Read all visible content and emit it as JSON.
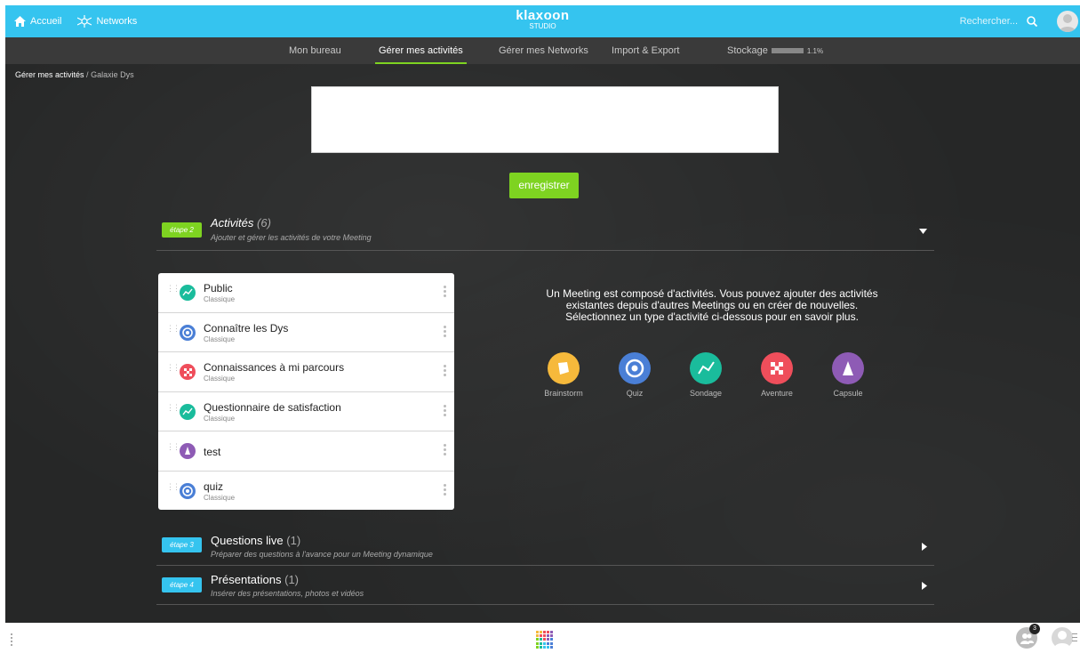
{
  "topbar": {
    "home_label": "Accueil",
    "networks_label": "Networks",
    "logo_line1": "klaxoon",
    "logo_line2": "STUDIO",
    "search_placeholder": "Rechercher..."
  },
  "subnav": {
    "tabs": [
      {
        "label": "Mon bureau"
      },
      {
        "label": "Gérer mes activités"
      },
      {
        "label": "Gérer mes Networks"
      },
      {
        "label": "Import & Export"
      },
      {
        "label": "Stockage"
      }
    ],
    "active_tab": "Gérer mes activités",
    "storage_pct": "1.1%"
  },
  "breadcrumb": {
    "root": "Gérer mes activités",
    "separator": "/",
    "current": "Galaxie Dys"
  },
  "save_label": "enregistrer",
  "steps": [
    {
      "badge": "étape 2",
      "title": "Activités",
      "count": "(6)",
      "subtitle": "Ajouter et gérer les activités de votre Meeting",
      "badge_color": "#7ed321"
    },
    {
      "badge": "étape 3",
      "title": "Questions live",
      "count": "(1)",
      "subtitle": "Préparer des questions à l'avance pour un Meeting dynamique",
      "badge_color": "#35c4ef"
    },
    {
      "badge": "étape 4",
      "title": "Présentations",
      "count": "(1)",
      "subtitle": "Insérer des présentations, photos et vidéos",
      "badge_color": "#35c4ef"
    }
  ],
  "activities": [
    {
      "name": "Public",
      "type": "Classique",
      "icon": "sondage-icon",
      "color": "#1abc9c"
    },
    {
      "name": "Connaître les Dys",
      "type": "Classique",
      "icon": "quiz-icon",
      "color": "#4a7fd6"
    },
    {
      "name": "Connaissances à mi parcours",
      "type": "Classique",
      "icon": "aventure-icon",
      "color": "#ef4e5b"
    },
    {
      "name": "Questionnaire de satisfaction",
      "type": "Classique",
      "icon": "sondage-icon",
      "color": "#1abc9c"
    },
    {
      "name": "test",
      "type": "",
      "icon": "capsule-icon",
      "color": "#8e5bb5"
    },
    {
      "name": "quiz",
      "type": "Classique",
      "icon": "quiz-icon",
      "color": "#4a7fd6"
    }
  ],
  "info_text": "Un Meeting est composé d'activités. Vous pouvez ajouter des activités existantes depuis d'autres Meetings ou en créer de nouvelles. Sélectionnez un type d'activité ci-dessous pour en savoir plus.",
  "activity_types": [
    {
      "label": "Brainstorm",
      "icon": "brainstorm-icon",
      "color": "#f6b93b"
    },
    {
      "label": "Quiz",
      "icon": "quiz-icon",
      "color": "#4a7fd6"
    },
    {
      "label": "Sondage",
      "icon": "sondage-icon",
      "color": "#1abc9c"
    },
    {
      "label": "Aventure",
      "icon": "aventure-icon",
      "color": "#ef4e5b"
    },
    {
      "label": "Capsule",
      "icon": "capsule-icon",
      "color": "#8e5bb5"
    }
  ],
  "bottombar": {
    "notif_count": "3"
  },
  "colors": {
    "brand": "#35c4ef",
    "accent_green": "#7ed321"
  }
}
